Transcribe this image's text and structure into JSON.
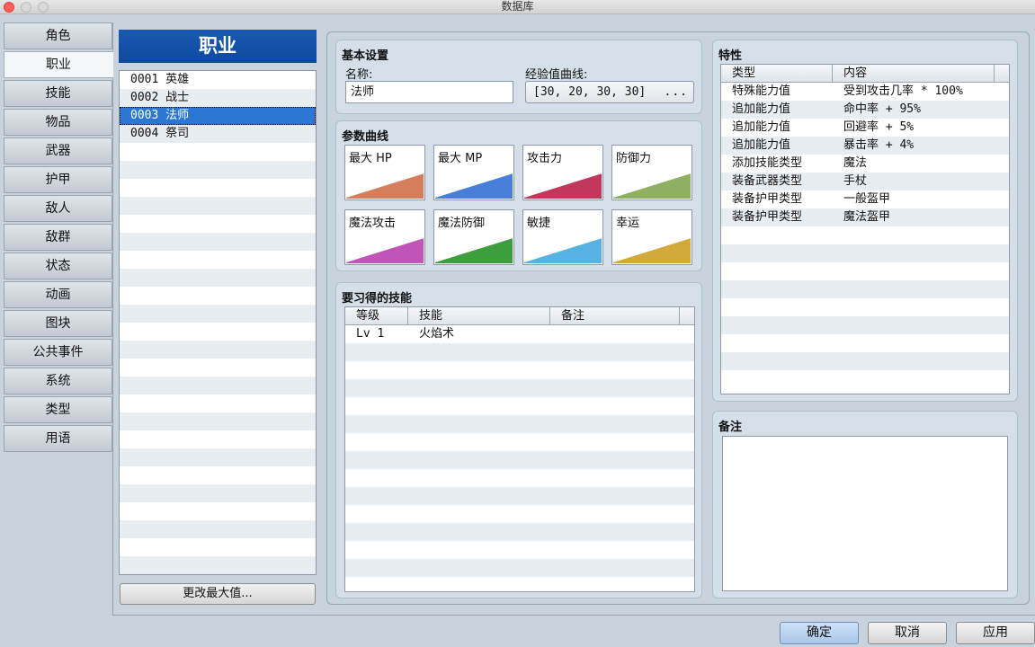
{
  "window": {
    "title": "数据库"
  },
  "tabs": [
    {
      "label": "角色"
    },
    {
      "label": "职业"
    },
    {
      "label": "技能"
    },
    {
      "label": "物品"
    },
    {
      "label": "武器"
    },
    {
      "label": "护甲"
    },
    {
      "label": "敌人"
    },
    {
      "label": "敌群"
    },
    {
      "label": "状态"
    },
    {
      "label": "动画"
    },
    {
      "label": "图块"
    },
    {
      "label": "公共事件"
    },
    {
      "label": "系统"
    },
    {
      "label": "类型"
    },
    {
      "label": "用语"
    }
  ],
  "active_tab": "职业",
  "class_list": {
    "header": "职业",
    "items": [
      {
        "label": "0001 英雄"
      },
      {
        "label": "0002 战士"
      },
      {
        "label": "0003 法师"
      },
      {
        "label": "0004 祭司"
      }
    ],
    "selected": "0003 法师",
    "change_max_button": "更改最大值..."
  },
  "basic_settings": {
    "title": "基本设置",
    "name_label": "名称:",
    "name_value": "法师",
    "exp_curve_label": "经验值曲线:",
    "exp_curve_value": "[30, 20, 30, 30]",
    "exp_curve_button": "..."
  },
  "param_curves": {
    "title": "参数曲线",
    "curves": [
      {
        "name": "最大 HP",
        "color": "#d47e5c",
        "level": 0.48
      },
      {
        "name": "最大 MP",
        "color": "#4a7fd9",
        "level": 0.48
      },
      {
        "name": "攻击力",
        "color": "#c2385a",
        "level": 0.48
      },
      {
        "name": "防御力",
        "color": "#8fb062",
        "level": 0.48
      },
      {
        "name": "魔法攻击",
        "color": "#c054b8",
        "level": 0.48
      },
      {
        "name": "魔法防御",
        "color": "#3d9e3d",
        "level": 0.48
      },
      {
        "name": "敏捷",
        "color": "#55b2e3",
        "level": 0.48
      },
      {
        "name": "幸运",
        "color": "#d3a93b",
        "level": 0.48
      }
    ]
  },
  "skills_to_learn": {
    "title": "要习得的技能",
    "columns": [
      "等级",
      "技能",
      "备注"
    ],
    "rows": [
      {
        "level": "Lv  1",
        "skill": "火焰术",
        "note": ""
      }
    ]
  },
  "traits": {
    "title": "特性",
    "columns": [
      "类型",
      "内容"
    ],
    "rows": [
      {
        "type": "特殊能力值",
        "content": "受到攻击几率 * 100%"
      },
      {
        "type": "追加能力值",
        "content": "命中率 + 95%"
      },
      {
        "type": "追加能力值",
        "content": "回避率 + 5%"
      },
      {
        "type": "追加能力值",
        "content": "暴击率 + 4%"
      },
      {
        "type": "添加技能类型",
        "content": "魔法"
      },
      {
        "type": "装备武器类型",
        "content": "手杖"
      },
      {
        "type": "装备护甲类型",
        "content": "一般盔甲"
      },
      {
        "type": "装备护甲类型",
        "content": "魔法盔甲"
      }
    ]
  },
  "note": {
    "title": "备注",
    "value": ""
  },
  "footer": {
    "ok": "确定",
    "cancel": "取消",
    "apply": "应用"
  }
}
